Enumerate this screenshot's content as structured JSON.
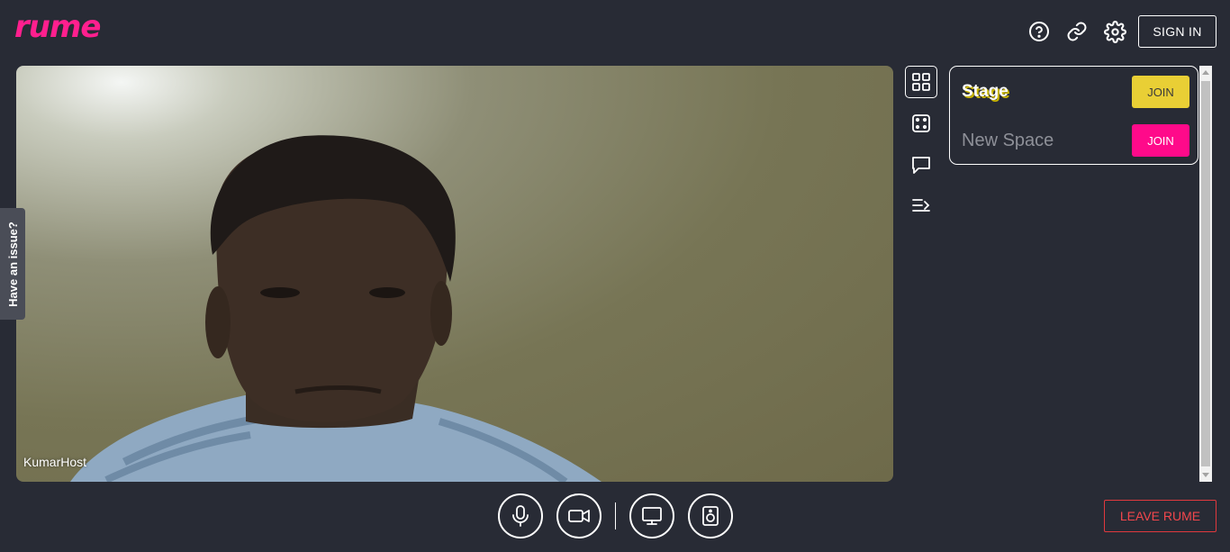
{
  "app": {
    "logo_text": "rume",
    "brand_color": "#ff1f8e"
  },
  "header": {
    "icons": [
      "help-icon",
      "link-icon",
      "settings-icon"
    ],
    "sign_in_label": "SIGN IN"
  },
  "video": {
    "participant_name": "KumarHost"
  },
  "issue_tab": {
    "label": "Have an issue?"
  },
  "side_icons": [
    "grid-view-icon",
    "dice-icon",
    "chat-icon",
    "collapse-panel-icon"
  ],
  "spaces": [
    {
      "name": "Stage",
      "join_label": "JOIN",
      "button_color": "#e9cf35"
    },
    {
      "name": "New Space",
      "join_label": "JOIN",
      "button_color": "#ff0a8a"
    }
  ],
  "controls": {
    "icons": [
      "microphone-icon",
      "camera-icon",
      "screen-share-icon",
      "speaker-icon"
    ],
    "leave_label": "LEAVE RUME",
    "leave_color": "#f2474c"
  }
}
